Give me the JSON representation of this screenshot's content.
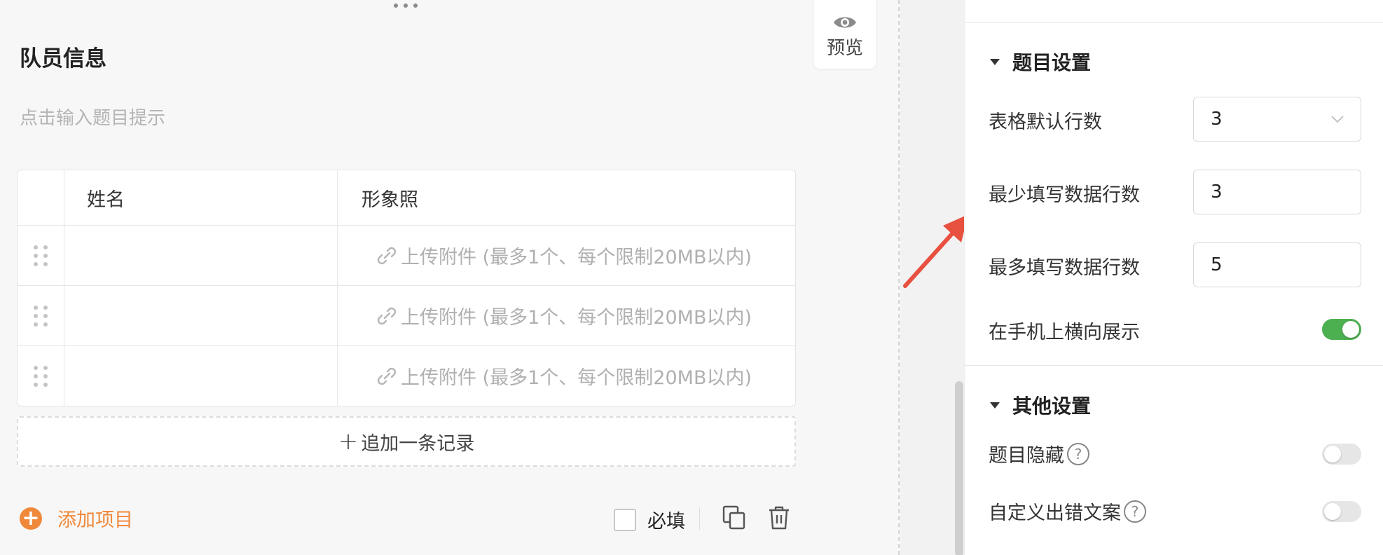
{
  "editor": {
    "question_title": "队员信息",
    "question_hint": "点击输入题目提示",
    "preview_label": "预览",
    "table": {
      "headers": [
        "姓名",
        "形象照"
      ],
      "rows": [
        {
          "upload_text": "上传附件 (最多1个、每个限制20MB以内)"
        },
        {
          "upload_text": "上传附件 (最多1个、每个限制20MB以内)"
        },
        {
          "upload_text": "上传附件 (最多1个、每个限制20MB以内)"
        }
      ]
    },
    "add_record_plus": "+",
    "add_record_label": "追加一条记录",
    "add_item_label": "添加项目",
    "required_label": "必填",
    "required_checked": false
  },
  "settings": {
    "question_section": {
      "title": "题目设置",
      "default_rows_label": "表格默认行数",
      "default_rows_value": "3",
      "min_rows_label": "最少填写数据行数",
      "min_rows_value": "3",
      "max_rows_label": "最多填写数据行数",
      "max_rows_value": "5",
      "mobile_horizontal_label": "在手机上横向展示",
      "mobile_horizontal_on": true
    },
    "other_section": {
      "title": "其他设置",
      "hide_question_label": "题目隐藏",
      "hide_question_on": false,
      "custom_error_label": "自定义出错文案",
      "custom_error_on": false,
      "help_glyph": "?"
    }
  },
  "colors": {
    "accent_orange": "#f0883a",
    "toggle_on": "#4caf50",
    "annotation_arrow": "#e8503f"
  },
  "icons": [
    "eye-icon",
    "drag-handle-icon",
    "paperclip-icon",
    "plus-icon",
    "add-circle-icon",
    "copy-icon",
    "trash-icon",
    "chevron-down-icon",
    "help-icon",
    "triangle-down-icon",
    "arrow-annotation"
  ]
}
